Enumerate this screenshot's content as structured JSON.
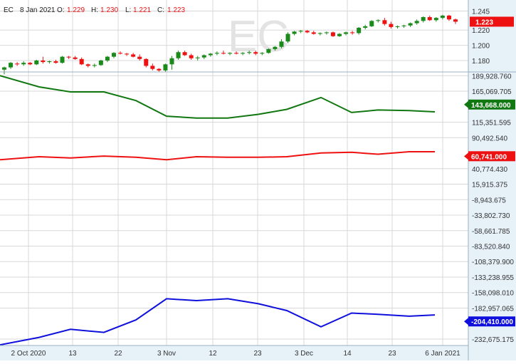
{
  "header": {
    "symbol": "EC",
    "date": "8 Jan 2021",
    "open_label": "O:",
    "open": "1.229",
    "high_label": "H:",
    "high": "1.230",
    "low_label": "L:",
    "low": "1.221",
    "close_label": "C:",
    "close": "1.223"
  },
  "watermark": "EC",
  "colors": {
    "bull": "#1a8a1a",
    "bear": "#ee1111",
    "green_line": "#117711",
    "red_line": "#ee1111",
    "blue_line": "#1010dd",
    "grid": "#d8d8d8",
    "axis_bg": "#e6f1f8"
  },
  "chart_data": [
    {
      "type": "candlestick",
      "title": "EC",
      "ylim": [
        1.165,
        1.252
      ],
      "yticks": [
        "1.245",
        "1.220",
        "1.200",
        "1.180"
      ],
      "last_value_label": "1.223",
      "candles": [
        {
          "o": 1.168,
          "h": 1.172,
          "l": 1.162,
          "c": 1.171
        },
        {
          "o": 1.171,
          "h": 1.178,
          "l": 1.169,
          "c": 1.177
        },
        {
          "o": 1.176,
          "h": 1.178,
          "l": 1.173,
          "c": 1.175
        },
        {
          "o": 1.175,
          "h": 1.179,
          "l": 1.173,
          "c": 1.177
        },
        {
          "o": 1.177,
          "h": 1.178,
          "l": 1.174,
          "c": 1.175
        },
        {
          "o": 1.175,
          "h": 1.181,
          "l": 1.174,
          "c": 1.18
        },
        {
          "o": 1.18,
          "h": 1.185,
          "l": 1.176,
          "c": 1.178
        },
        {
          "o": 1.178,
          "h": 1.18,
          "l": 1.176,
          "c": 1.179
        },
        {
          "o": 1.179,
          "h": 1.181,
          "l": 1.176,
          "c": 1.177
        },
        {
          "o": 1.177,
          "h": 1.186,
          "l": 1.176,
          "c": 1.185
        },
        {
          "o": 1.185,
          "h": 1.186,
          "l": 1.182,
          "c": 1.184
        },
        {
          "o": 1.184,
          "h": 1.186,
          "l": 1.181,
          "c": 1.182
        },
        {
          "o": 1.182,
          "h": 1.184,
          "l": 1.174,
          "c": 1.175
        },
        {
          "o": 1.175,
          "h": 1.176,
          "l": 1.171,
          "c": 1.173
        },
        {
          "o": 1.173,
          "h": 1.176,
          "l": 1.171,
          "c": 1.174
        },
        {
          "o": 1.174,
          "h": 1.181,
          "l": 1.173,
          "c": 1.18
        },
        {
          "o": 1.18,
          "h": 1.186,
          "l": 1.178,
          "c": 1.185
        },
        {
          "o": 1.185,
          "h": 1.191,
          "l": 1.183,
          "c": 1.19
        },
        {
          "o": 1.19,
          "h": 1.192,
          "l": 1.188,
          "c": 1.189
        },
        {
          "o": 1.189,
          "h": 1.19,
          "l": 1.186,
          "c": 1.188
        },
        {
          "o": 1.188,
          "h": 1.19,
          "l": 1.184,
          "c": 1.185
        },
        {
          "o": 1.185,
          "h": 1.188,
          "l": 1.18,
          "c": 1.182
        },
        {
          "o": 1.182,
          "h": 1.183,
          "l": 1.171,
          "c": 1.173
        },
        {
          "o": 1.173,
          "h": 1.176,
          "l": 1.167,
          "c": 1.169
        },
        {
          "o": 1.169,
          "h": 1.17,
          "l": 1.165,
          "c": 1.167
        },
        {
          "o": 1.167,
          "h": 1.176,
          "l": 1.165,
          "c": 1.175
        },
        {
          "o": 1.175,
          "h": 1.186,
          "l": 1.168,
          "c": 1.183
        },
        {
          "o": 1.183,
          "h": 1.193,
          "l": 1.181,
          "c": 1.191
        },
        {
          "o": 1.191,
          "h": 1.193,
          "l": 1.186,
          "c": 1.187
        },
        {
          "o": 1.187,
          "h": 1.189,
          "l": 1.181,
          "c": 1.183
        },
        {
          "o": 1.183,
          "h": 1.186,
          "l": 1.18,
          "c": 1.184
        },
        {
          "o": 1.184,
          "h": 1.188,
          "l": 1.182,
          "c": 1.187
        },
        {
          "o": 1.187,
          "h": 1.19,
          "l": 1.185,
          "c": 1.189
        },
        {
          "o": 1.189,
          "h": 1.192,
          "l": 1.187,
          "c": 1.19
        },
        {
          "o": 1.19,
          "h": 1.193,
          "l": 1.188,
          "c": 1.189
        },
        {
          "o": 1.189,
          "h": 1.191,
          "l": 1.187,
          "c": 1.19
        },
        {
          "o": 1.19,
          "h": 1.192,
          "l": 1.188,
          "c": 1.189
        },
        {
          "o": 1.189,
          "h": 1.191,
          "l": 1.187,
          "c": 1.19
        },
        {
          "o": 1.19,
          "h": 1.193,
          "l": 1.188,
          "c": 1.191
        },
        {
          "o": 1.191,
          "h": 1.193,
          "l": 1.187,
          "c": 1.189
        },
        {
          "o": 1.189,
          "h": 1.191,
          "l": 1.187,
          "c": 1.19
        },
        {
          "o": 1.19,
          "h": 1.196,
          "l": 1.189,
          "c": 1.195
        },
        {
          "o": 1.195,
          "h": 1.199,
          "l": 1.193,
          "c": 1.198
        },
        {
          "o": 1.198,
          "h": 1.208,
          "l": 1.196,
          "c": 1.205
        },
        {
          "o": 1.205,
          "h": 1.217,
          "l": 1.203,
          "c": 1.215
        },
        {
          "o": 1.215,
          "h": 1.219,
          "l": 1.213,
          "c": 1.218
        },
        {
          "o": 1.218,
          "h": 1.22,
          "l": 1.216,
          "c": 1.219
        },
        {
          "o": 1.219,
          "h": 1.22,
          "l": 1.216,
          "c": 1.217
        },
        {
          "o": 1.217,
          "h": 1.219,
          "l": 1.214,
          "c": 1.215
        },
        {
          "o": 1.215,
          "h": 1.217,
          "l": 1.213,
          "c": 1.216
        },
        {
          "o": 1.216,
          "h": 1.218,
          "l": 1.214,
          "c": 1.217
        },
        {
          "o": 1.217,
          "h": 1.218,
          "l": 1.211,
          "c": 1.212
        },
        {
          "o": 1.212,
          "h": 1.216,
          "l": 1.211,
          "c": 1.215
        },
        {
          "o": 1.215,
          "h": 1.218,
          "l": 1.213,
          "c": 1.217
        },
        {
          "o": 1.217,
          "h": 1.219,
          "l": 1.214,
          "c": 1.216
        },
        {
          "o": 1.216,
          "h": 1.224,
          "l": 1.214,
          "c": 1.223
        },
        {
          "o": 1.223,
          "h": 1.227,
          "l": 1.221,
          "c": 1.225
        },
        {
          "o": 1.225,
          "h": 1.233,
          "l": 1.224,
          "c": 1.232
        },
        {
          "o": 1.232,
          "h": 1.234,
          "l": 1.23,
          "c": 1.233
        },
        {
          "o": 1.233,
          "h": 1.236,
          "l": 1.226,
          "c": 1.228
        },
        {
          "o": 1.228,
          "h": 1.231,
          "l": 1.222,
          "c": 1.224
        },
        {
          "o": 1.224,
          "h": 1.226,
          "l": 1.222,
          "c": 1.225
        },
        {
          "o": 1.225,
          "h": 1.227,
          "l": 1.223,
          "c": 1.226
        },
        {
          "o": 1.226,
          "h": 1.23,
          "l": 1.224,
          "c": 1.229
        },
        {
          "o": 1.229,
          "h": 1.234,
          "l": 1.227,
          "c": 1.232
        },
        {
          "o": 1.232,
          "h": 1.238,
          "l": 1.23,
          "c": 1.237
        },
        {
          "o": 1.237,
          "h": 1.239,
          "l": 1.232,
          "c": 1.233
        },
        {
          "o": 1.233,
          "h": 1.237,
          "l": 1.231,
          "c": 1.236
        },
        {
          "o": 1.236,
          "h": 1.24,
          "l": 1.234,
          "c": 1.239
        },
        {
          "o": 1.239,
          "h": 1.24,
          "l": 1.232,
          "c": 1.234
        },
        {
          "o": 1.234,
          "h": 1.235,
          "l": 1.228,
          "c": 1.231
        }
      ]
    },
    {
      "type": "line",
      "ylim": [
        -243000,
        196000
      ],
      "yticks": [
        "189,928.760",
        "165,069.705",
        "115,351.595",
        "90,492.540",
        "40,774.430",
        "15,915.375",
        "-8,943.675",
        "-33,802.730",
        "-58,661.785",
        "-83,520.840",
        "-108,379.900",
        "-133,238.955",
        "-158,098.010",
        "-182,957.065",
        "-232,675.175"
      ],
      "x": [
        0,
        1,
        2,
        3,
        4,
        5,
        6,
        7,
        8,
        9,
        10,
        11,
        12,
        13,
        14
      ],
      "series": [
        {
          "values": [
            190000,
            172000,
            164000,
            164000,
            150000,
            125000,
            122000,
            122000,
            128000,
            136000,
            155000,
            131000,
            135000,
            134000,
            132000
          ],
          "last_label": "143,668.000"
        },
        {
          "values": [
            55000,
            60000,
            58000,
            61000,
            59000,
            55000,
            60000,
            59000,
            59000,
            60000,
            66000,
            67000,
            64000,
            68000,
            68000
          ],
          "last_label": "60,741.000"
        },
        {
          "values": [
            -242000,
            -230000,
            -217000,
            -222000,
            -202000,
            -168000,
            -171000,
            -168000,
            -176000,
            -187000,
            -213000,
            -191000,
            -193000,
            -196000,
            -194000
          ],
          "last_label": "-204,410.000"
        }
      ]
    }
  ],
  "x_labels": [
    "2 Oct 2020",
    "13",
    "22",
    "3 Nov",
    "12",
    "23",
    "3 Dec",
    "14",
    "23",
    "6 Jan 2021"
  ]
}
